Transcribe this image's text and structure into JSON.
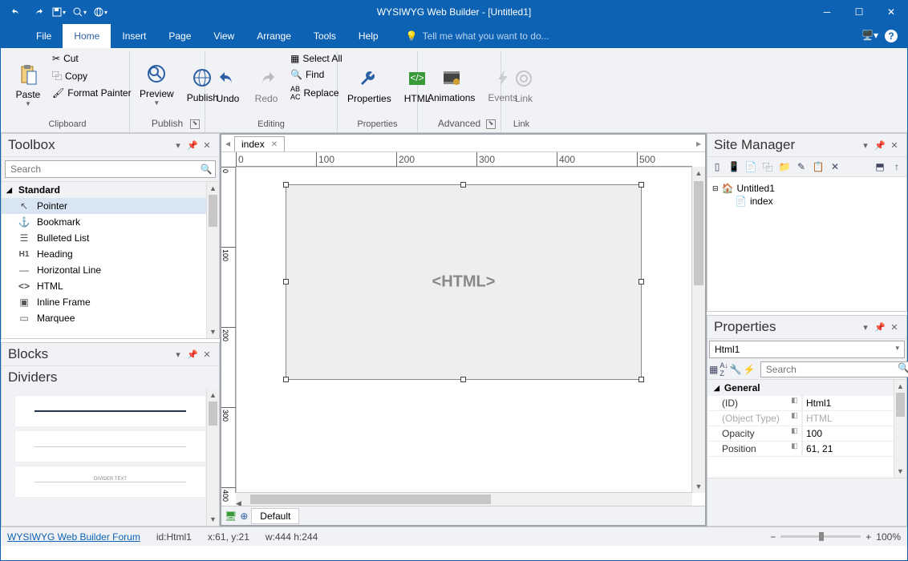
{
  "title": "WYSIWYG Web Builder - [Untitled1]",
  "menu": {
    "file": "File",
    "home": "Home",
    "insert": "Insert",
    "page": "Page",
    "view": "View",
    "arrange": "Arrange",
    "tools": "Tools",
    "help": "Help",
    "tell": "Tell me what you want to do..."
  },
  "ribbon": {
    "paste": "Paste",
    "cut": "Cut",
    "copy": "Copy",
    "format": "Format Painter",
    "clipboard": "Clipboard",
    "preview": "Preview",
    "publish": "Publish",
    "publish_g": "Publish",
    "undo": "Undo",
    "redo": "Redo",
    "selectall": "Select All",
    "find": "Find",
    "replace": "Replace",
    "editing": "Editing",
    "properties": "Properties",
    "html": "HTML",
    "properties_g": "Properties",
    "animations": "Animations",
    "events": "Events",
    "advanced": "Advanced",
    "link": "Link",
    "link_g": "Link"
  },
  "toolbox": {
    "title": "Toolbox",
    "search": "Search",
    "cat": "Standard",
    "items": [
      "Pointer",
      "Bookmark",
      "Bulleted List",
      "Heading",
      "Horizontal Line",
      "HTML",
      "Inline Frame",
      "Marquee"
    ]
  },
  "blocks": {
    "title": "Blocks",
    "section": "Dividers"
  },
  "doc_tab": "index",
  "canvas_placeholder": "<HTML>",
  "ruler_h": [
    0,
    100,
    200,
    300,
    400,
    500
  ],
  "ruler_v": [
    0,
    100,
    200,
    300,
    400
  ],
  "bottom_default": "Default",
  "site": {
    "title": "Site Manager",
    "root": "Untitled1",
    "page": "index"
  },
  "props": {
    "title": "Properties",
    "selected": "Html1",
    "search": "Search",
    "cat": "General",
    "rows": [
      {
        "name": "(ID)",
        "value": "Html1"
      },
      {
        "name": "(Object Type)",
        "value": "HTML",
        "dis": true
      },
      {
        "name": "Opacity",
        "value": "100"
      },
      {
        "name": "Position",
        "value": "61, 21"
      }
    ]
  },
  "status": {
    "forum": "WYSIWYG Web Builder Forum",
    "id": "id:Html1",
    "xy": "x:61, y:21",
    "wh": "w:444 h:244",
    "zoom": "100%"
  }
}
